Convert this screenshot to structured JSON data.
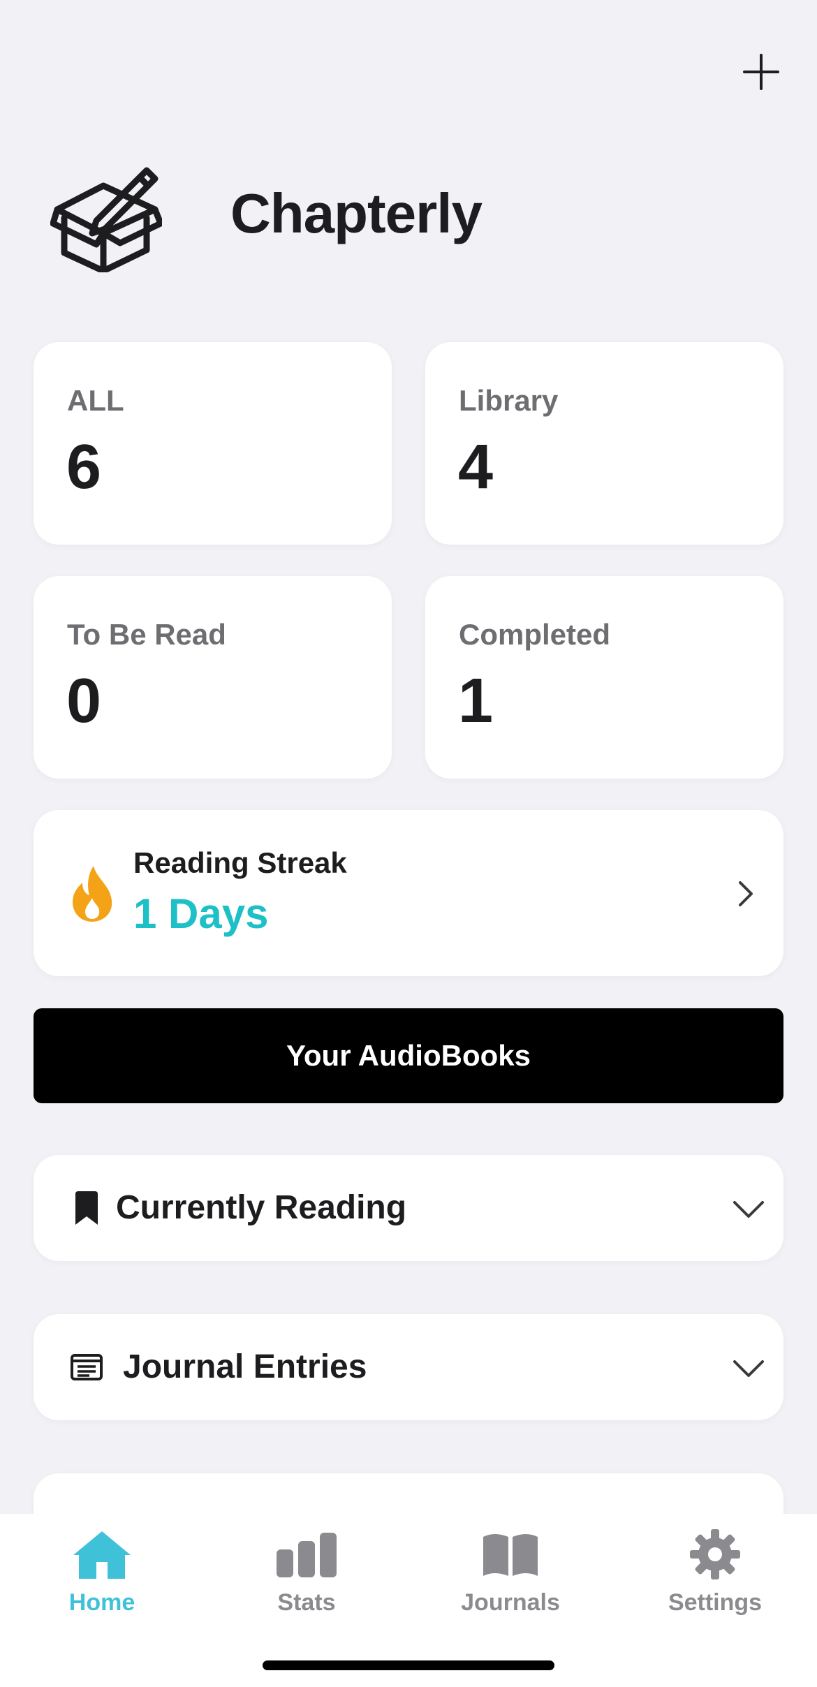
{
  "header": {
    "add_icon": "plus-icon"
  },
  "brand": {
    "title": "Chapterly",
    "logo_icon": "box-with-pen-icon"
  },
  "stats": [
    {
      "label": "ALL",
      "value": "6"
    },
    {
      "label": "Library",
      "value": "4"
    },
    {
      "label": "To Be Read",
      "value": "0"
    },
    {
      "label": "Completed",
      "value": "1"
    }
  ],
  "streak": {
    "label": "Reading Streak",
    "value": "1 Days",
    "icon": "flame-icon",
    "accent": "#1ec0c8",
    "flame_color": "#f5a316"
  },
  "audiobooks_button": {
    "label": "Your AudioBooks"
  },
  "sections": [
    {
      "title": "Currently Reading",
      "icon": "bookmark-icon"
    },
    {
      "title": "Journal Entries",
      "icon": "journal-entry-icon"
    }
  ],
  "tabs": [
    {
      "label": "Home",
      "icon": "home-icon",
      "active": true
    },
    {
      "label": "Stats",
      "icon": "bar-chart-icon",
      "active": false
    },
    {
      "label": "Journals",
      "icon": "open-book-icon",
      "active": false
    },
    {
      "label": "Settings",
      "icon": "gear-icon",
      "active": false
    }
  ],
  "colors": {
    "background": "#f1f1f6",
    "active_tab": "#3fc2d8",
    "inactive_tab": "#8b8b8f"
  }
}
